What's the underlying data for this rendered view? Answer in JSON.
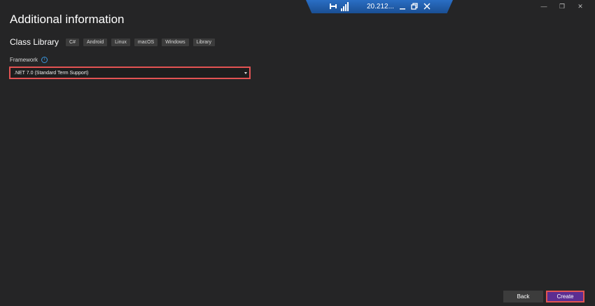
{
  "page": {
    "title": "Additional information"
  },
  "rdp_bar": {
    "address": "20.212...",
    "icons": [
      "pin-icon",
      "signal-icon",
      "minimize-icon",
      "restore-icon",
      "close-icon"
    ]
  },
  "window_controls": {
    "minimize": "—",
    "restore": "❐",
    "close": "✕"
  },
  "project": {
    "name": "Class Library",
    "tags": [
      "C#",
      "Android",
      "Linux",
      "macOS",
      "Windows",
      "Library"
    ]
  },
  "framework": {
    "label": "Framework",
    "info_icon": "i",
    "selected": ".NET 7.0 (Standard Term Support)"
  },
  "buttons": {
    "back": "Back",
    "create": "Create"
  },
  "colors": {
    "background": "#252526",
    "highlight": "#e35353",
    "accent": "#5c2d91",
    "rdp_bar": "#1a4f93"
  }
}
